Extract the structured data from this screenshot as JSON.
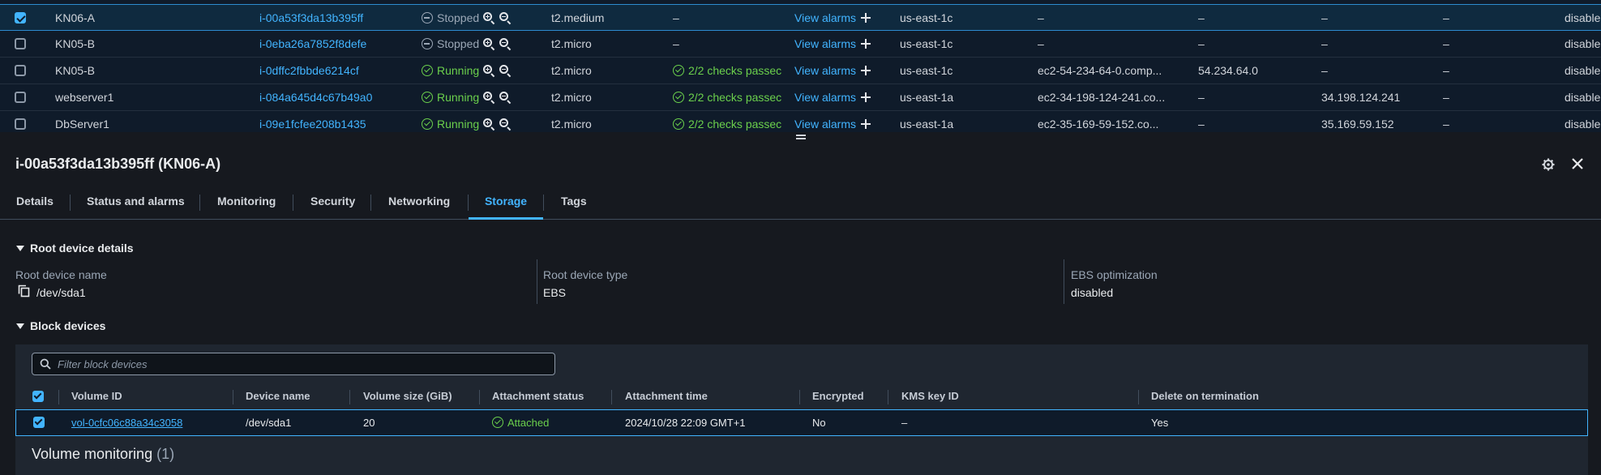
{
  "instances": [
    {
      "name": "KN06-A",
      "id": "i-00a53f3da13b395ff",
      "state": "Stopped",
      "type": "t2.medium",
      "checks": "–",
      "alarms": "View alarms",
      "az": "us-east-1c",
      "dns": "–",
      "ipv4": "–",
      "elastic": "–",
      "ipv6": "–",
      "monitoring": "disable",
      "selected": true
    },
    {
      "name": "KN05-B",
      "id": "i-0eba26a7852f8defe",
      "state": "Stopped",
      "type": "t2.micro",
      "checks": "–",
      "alarms": "View alarms",
      "az": "us-east-1c",
      "dns": "–",
      "ipv4": "–",
      "elastic": "–",
      "ipv6": "–",
      "monitoring": "disable",
      "selected": false
    },
    {
      "name": "KN05-B",
      "id": "i-0dffc2fbbde6214cf",
      "state": "Running",
      "type": "t2.micro",
      "checks": "2/2 checks passec",
      "alarms": "View alarms",
      "az": "us-east-1c",
      "dns": "ec2-54-234-64-0.comp...",
      "ipv4": "54.234.64.0",
      "elastic": "–",
      "ipv6": "–",
      "monitoring": "disable",
      "selected": false
    },
    {
      "name": "webserver1",
      "id": "i-084a645d4c67b49a0",
      "state": "Running",
      "type": "t2.micro",
      "checks": "2/2 checks passec",
      "alarms": "View alarms",
      "az": "us-east-1a",
      "dns": "ec2-34-198-124-241.co...",
      "ipv4": "–",
      "elastic": "34.198.124.241",
      "ipv6": "–",
      "monitoring": "disable",
      "selected": false
    },
    {
      "name": "DbServer1",
      "id": "i-09e1fcfee208b1435",
      "state": "Running",
      "type": "t2.micro",
      "checks": "2/2 checks passec",
      "alarms": "View alarms",
      "az": "us-east-1a",
      "dns": "ec2-35-169-59-152.co...",
      "ipv4": "–",
      "elastic": "35.169.59.152",
      "ipv6": "–",
      "monitoring": "disable",
      "selected": false
    }
  ],
  "panel": {
    "title": "i-00a53f3da13b395ff (KN06-A)",
    "tabs": [
      "Details",
      "Status and alarms",
      "Monitoring",
      "Security",
      "Networking",
      "Storage",
      "Tags"
    ],
    "active_tab": "Storage"
  },
  "root_device": {
    "heading": "Root device details",
    "name_label": "Root device name",
    "name_value": "/dev/sda1",
    "type_label": "Root device type",
    "type_value": "EBS",
    "ebs_label": "EBS optimization",
    "ebs_value": "disabled"
  },
  "block_devices": {
    "heading": "Block devices",
    "filter_placeholder": "Filter block devices",
    "columns": [
      "Volume ID",
      "Device name",
      "Volume size (GiB)",
      "Attachment status",
      "Attachment time",
      "Encrypted",
      "KMS key ID",
      "Delete on termination"
    ],
    "rows": [
      {
        "volume_id": "vol-0cfc06c88a34c3058",
        "device": "/dev/sda1",
        "size": "20",
        "status": "Attached",
        "time": "2024/10/28 22:09 GMT+1",
        "encrypted": "No",
        "kms": "–",
        "delete": "Yes"
      }
    ]
  },
  "volume_monitoring": {
    "label": "Volume monitoring",
    "count": "(1)"
  },
  "colors": {
    "accent": "#42b4ff",
    "running": "#6bd04c",
    "background": "#16191f",
    "table_bg": "#0f1b2a"
  },
  "icons": [
    "checkbox-icon",
    "stopped-icon",
    "running-icon",
    "zoom-in-icon",
    "zoom-out-icon",
    "plus-icon",
    "check-circle-icon",
    "gear-icon",
    "close-icon",
    "copy-icon",
    "search-icon",
    "caret-down-icon",
    "splitter-grip-icon"
  ]
}
